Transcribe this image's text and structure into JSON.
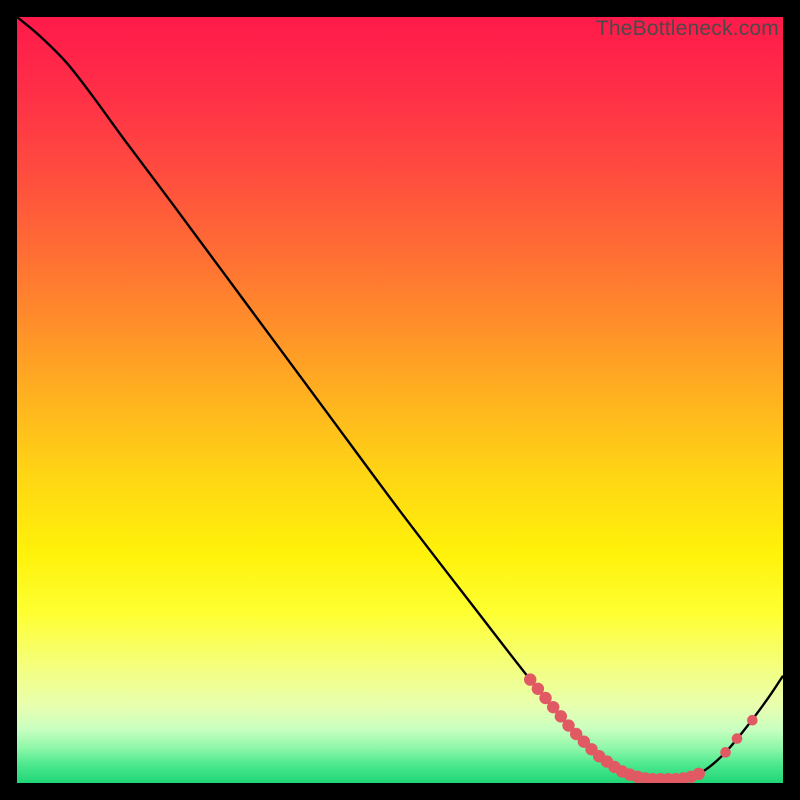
{
  "watermark": "TheBottleneck.com",
  "chart_data": {
    "type": "line",
    "title": "",
    "xlabel": "",
    "ylabel": "",
    "xlim": [
      0,
      100
    ],
    "ylim": [
      0,
      100
    ],
    "grid": false,
    "legend": false,
    "gradient_stops": [
      {
        "offset": 0.0,
        "color": "#ff1a4b"
      },
      {
        "offset": 0.1,
        "color": "#ff2f47"
      },
      {
        "offset": 0.2,
        "color": "#ff4b3f"
      },
      {
        "offset": 0.3,
        "color": "#ff6b35"
      },
      {
        "offset": 0.4,
        "color": "#ff8e2a"
      },
      {
        "offset": 0.5,
        "color": "#ffb31f"
      },
      {
        "offset": 0.6,
        "color": "#ffd614"
      },
      {
        "offset": 0.7,
        "color": "#fff20a"
      },
      {
        "offset": 0.78,
        "color": "#feff33"
      },
      {
        "offset": 0.85,
        "color": "#f4ff80"
      },
      {
        "offset": 0.9,
        "color": "#e8ffb0"
      },
      {
        "offset": 0.93,
        "color": "#c8ffc0"
      },
      {
        "offset": 0.955,
        "color": "#8cf7a8"
      },
      {
        "offset": 0.975,
        "color": "#4fe98f"
      },
      {
        "offset": 1.0,
        "color": "#1fd676"
      }
    ],
    "curve": [
      {
        "x": 0.0,
        "y": 100.0
      },
      {
        "x": 3.0,
        "y": 97.5
      },
      {
        "x": 6.5,
        "y": 94.0
      },
      {
        "x": 10.0,
        "y": 89.5
      },
      {
        "x": 14.0,
        "y": 84.0
      },
      {
        "x": 20.0,
        "y": 76.0
      },
      {
        "x": 30.0,
        "y": 62.5
      },
      {
        "x": 40.0,
        "y": 49.0
      },
      {
        "x": 50.0,
        "y": 35.5
      },
      {
        "x": 60.0,
        "y": 22.5
      },
      {
        "x": 67.0,
        "y": 13.5
      },
      {
        "x": 72.0,
        "y": 7.5
      },
      {
        "x": 76.0,
        "y": 3.5
      },
      {
        "x": 79.0,
        "y": 1.5
      },
      {
        "x": 82.0,
        "y": 0.6
      },
      {
        "x": 86.0,
        "y": 0.5
      },
      {
        "x": 89.0,
        "y": 1.2
      },
      {
        "x": 92.0,
        "y": 3.5
      },
      {
        "x": 95.0,
        "y": 7.0
      },
      {
        "x": 98.0,
        "y": 11.0
      },
      {
        "x": 100.0,
        "y": 14.0
      }
    ],
    "markers_dense": [
      {
        "x": 67.0,
        "y": 13.5
      },
      {
        "x": 68.0,
        "y": 12.3
      },
      {
        "x": 69.0,
        "y": 11.1
      },
      {
        "x": 70.0,
        "y": 9.9
      },
      {
        "x": 71.0,
        "y": 8.7
      },
      {
        "x": 72.0,
        "y": 7.5
      },
      {
        "x": 73.0,
        "y": 6.4
      },
      {
        "x": 74.0,
        "y": 5.4
      },
      {
        "x": 75.0,
        "y": 4.4
      },
      {
        "x": 76.0,
        "y": 3.5
      },
      {
        "x": 77.0,
        "y": 2.8
      },
      {
        "x": 78.0,
        "y": 2.1
      },
      {
        "x": 79.0,
        "y": 1.5
      },
      {
        "x": 80.0,
        "y": 1.1
      },
      {
        "x": 81.0,
        "y": 0.8
      },
      {
        "x": 82.0,
        "y": 0.6
      },
      {
        "x": 83.0,
        "y": 0.5
      },
      {
        "x": 84.0,
        "y": 0.5
      },
      {
        "x": 85.0,
        "y": 0.5
      },
      {
        "x": 86.0,
        "y": 0.5
      },
      {
        "x": 87.0,
        "y": 0.6
      },
      {
        "x": 88.0,
        "y": 0.8
      },
      {
        "x": 89.0,
        "y": 1.2
      }
    ],
    "markers_sparse": [
      {
        "x": 92.5,
        "y": 4.0
      },
      {
        "x": 94.0,
        "y": 5.8
      },
      {
        "x": 96.0,
        "y": 8.2
      }
    ],
    "marker_color": "#e15a63",
    "line_color": "#000000"
  }
}
